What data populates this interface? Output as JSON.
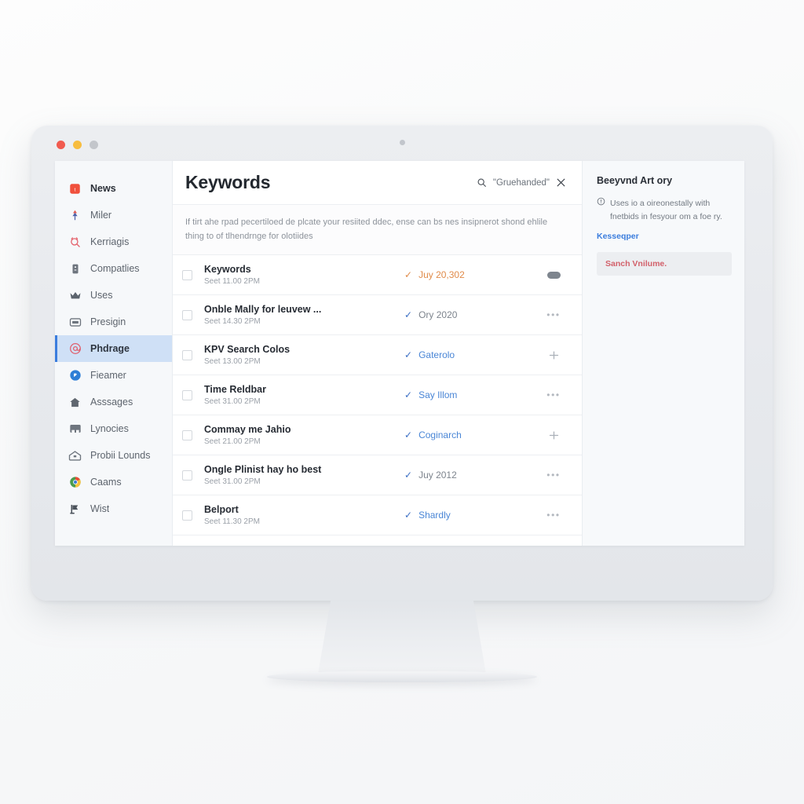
{
  "window": {
    "traffic_lights": [
      "close",
      "minimize",
      "maximize"
    ]
  },
  "sidebar": {
    "items": [
      {
        "label": "News",
        "icon": "news-square-icon",
        "style": "strong",
        "active": false
      },
      {
        "label": "Miler",
        "icon": "pin-icon",
        "style": "normal",
        "active": false
      },
      {
        "label": "Kerriagis",
        "icon": "search-alarm-icon",
        "style": "normal",
        "active": false
      },
      {
        "label": "Compatlies",
        "icon": "server-icon",
        "style": "normal",
        "active": false
      },
      {
        "label": "Uses",
        "icon": "crown-icon",
        "style": "normal",
        "active": false
      },
      {
        "label": "Presigin",
        "icon": "card-icon",
        "style": "normal",
        "active": false
      },
      {
        "label": "Phdrage",
        "icon": "at-circle-icon",
        "style": "normal",
        "active": true
      },
      {
        "label": "Fieamer",
        "icon": "badge-circle-icon",
        "style": "normal",
        "active": false
      },
      {
        "label": "Asssages",
        "icon": "home-icon",
        "style": "normal",
        "active": false
      },
      {
        "label": "Lynocies",
        "icon": "drawer-icon",
        "style": "normal",
        "active": false
      },
      {
        "label": "Probii Lounds",
        "icon": "briefcase-icon",
        "style": "normal",
        "active": false
      },
      {
        "label": "Caams",
        "icon": "chrome-icon",
        "style": "normal",
        "active": false
      },
      {
        "label": "Wist",
        "icon": "flag-person-icon",
        "style": "normal",
        "active": false
      }
    ]
  },
  "main": {
    "title": "Keywords",
    "search": {
      "icon": "search-icon",
      "term": "\"Gruehanded\"",
      "clear_icon": "close-icon"
    },
    "description": "If tirt ahe rpad pecertiloed de plcate your resiited ddec, ense can bs nes insipnerot shond ehlile thing to of tlhendrnge for olotiides",
    "rows": [
      {
        "title": "Keywords",
        "subtitle": "Seet 11.00 2PM",
        "status": "Juy 20,302",
        "status_color": "#e08b4a",
        "check_color": "#e08b4a",
        "action": "pill-toggle"
      },
      {
        "title": "Onble Mally for leuvew ...",
        "subtitle": "Seet 14.30 2PM",
        "status": "Ory 2020",
        "status_color": "#7d848d",
        "check_color": "#3b6fc4",
        "action": "more-dots"
      },
      {
        "title": "KPV Search Colos",
        "subtitle": "Seet 13.00 2PM",
        "status": "Gaterolo",
        "status_color": "#4a86d6",
        "check_color": "#3b6fc4",
        "action": "plus-handle"
      },
      {
        "title": "Time Reldbar",
        "subtitle": "Seet 31.00 2PM",
        "status": "Say Illom",
        "status_color": "#4a86d6",
        "check_color": "#3b6fc4",
        "action": "more-dots"
      },
      {
        "title": "Commay me Jahio",
        "subtitle": "Seet 21.00 2PM",
        "status": "Coginarch",
        "status_color": "#4a86d6",
        "check_color": "#3b6fc4",
        "action": "plus-handle"
      },
      {
        "title": "Ongle Plinist hay ho best",
        "subtitle": "Seet 31.00 2PM",
        "status": "Juy 2012",
        "status_color": "#7d848d",
        "check_color": "#3b6fc4",
        "action": "more-dots"
      },
      {
        "title": "Belport",
        "subtitle": "Seet 11.30 2PM",
        "status": "Shardly",
        "status_color": "#4a86d6",
        "check_color": "#3b6fc4",
        "action": "more-dots"
      }
    ]
  },
  "right_panel": {
    "title": "Beeyvnd Art ory",
    "note_icon": "info-icon",
    "note": "Uses io a oireonestally with fnetbids in fesyour om a foe ry.",
    "link": "Kesseqper",
    "box_text": "Sanch Vnilume."
  },
  "colors": {
    "accent_blue": "#3b7ddd",
    "accent_orange": "#e08b4a",
    "accent_red": "#d2606a",
    "active_bg": "#cfe0f6"
  }
}
